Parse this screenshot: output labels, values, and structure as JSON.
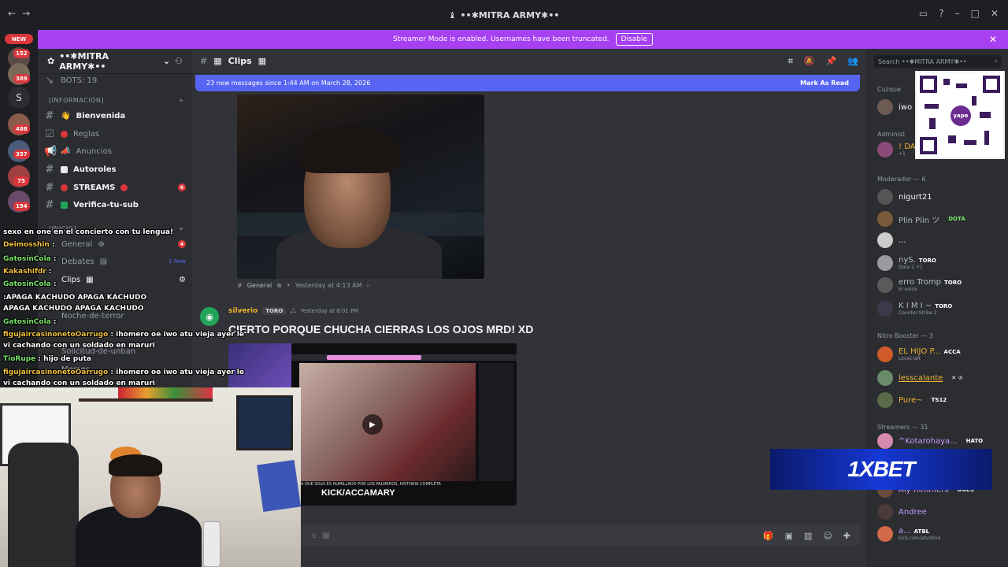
{
  "window": {
    "title": "••✱MITRA ARMY✱••"
  },
  "streamer_mode": {
    "message": "Streamer Mode is enabled. Usernames have been truncated.",
    "disable_label": "Disable"
  },
  "server_rail": {
    "new_label": "NEW",
    "badges": [
      "152",
      "389",
      "488",
      "357",
      "75",
      "194"
    ],
    "letter": "S"
  },
  "server": {
    "name": "••✱MITRA ARMY✱••",
    "bots_label": "BOTS: 19",
    "category_info": "[INFORMACIÓN]",
    "channels": [
      {
        "name": "Bienvenida",
        "bold": true
      },
      {
        "name": "Reglas",
        "bold": false
      },
      {
        "name": "Anuncios",
        "bold": false
      },
      {
        "name": "Autoroles",
        "bold": true
      },
      {
        "name": "STREAMS",
        "bold": true,
        "unread": "6"
      },
      {
        "name": "Verifica-tu-sub",
        "bold": true
      }
    ],
    "category_inicio": "[INICIO]",
    "lower_channels": [
      {
        "name": "General",
        "unread": "4"
      },
      {
        "name": "Debates",
        "note": "1 New"
      },
      {
        "name": "Clips"
      },
      {
        "name": "Noche-de-terror"
      },
      {
        "name": "Solicitud-de-unban"
      },
      {
        "name": "Memes"
      }
    ]
  },
  "channel_header": {
    "name": "Clips",
    "search_placeholder": "Search ••✱MITRA ARMY✱••"
  },
  "new_messages_bar": {
    "text": "23 new messages since 1:44 AM on March 28, 2026",
    "mark_read": "Mark As Read"
  },
  "forwarded": {
    "channel": "General",
    "time": "Yesterday at 4:13 AM"
  },
  "message": {
    "author": "silverio",
    "role": "TORO",
    "time": "Yesterday at 8:01 PM",
    "text": "CIERTO PORQUE CHUCHA CIERRAS LOS OJOS MRD! XD",
    "video_overlay": "KICK/ACCAMARY",
    "video_caption": "A QUE SOLO ES HUMILLADO POR LOS PALMEROS, HISTORIA COMPLETA"
  },
  "composer": {
    "placeholder_fragment": "s"
  },
  "members": {
    "groups": [
      {
        "label": "Cuzque",
        "members": [
          {
            "name": "iwo"
          }
        ]
      },
      {
        "label": "Administ",
        "members": [
          {
            "name": "! DA",
            "sub": "+1"
          }
        ]
      },
      {
        "label": "Moderador — 6",
        "members": [
          {
            "name": "nigurt21"
          },
          {
            "name": "Plin Plin ツ",
            "tag": "DOTA"
          },
          {
            "name": "..."
          },
          {
            "name": "nyS.",
            "tag": "TORO",
            "sub": "Dota 2 +1"
          },
          {
            "name": "erro Tromp",
            "tag": "TORO",
            "sub": "In voice"
          },
          {
            "name": "K I M I ~",
            "tag": "TORO",
            "sub": "Counter-Strike 2"
          }
        ]
      },
      {
        "label": "Nitro Booster — 3",
        "members": [
          {
            "name": "EL HIJO P...",
            "tag": "ACCA",
            "sub": "Lovecraft"
          },
          {
            "name": "lesscalante",
            "tag": "✕ ♔"
          },
          {
            "name": "Pure~",
            "tag": "TS12"
          }
        ]
      },
      {
        "label": "Streamers — 31",
        "members": [
          {
            "name": "^Kotarohaya...",
            "tag": "HATO"
          },
          {
            "name": "Aly Rimmers",
            "tag": "OUES"
          },
          {
            "name": "Andree"
          },
          {
            "name": "a...",
            "tag": "ATBL",
            "sub": "kick.com/atustina"
          }
        ]
      }
    ]
  },
  "qr": {
    "brand": "yape"
  },
  "ad": {
    "text": "1XBET"
  },
  "stream_chat": {
    "lines": [
      {
        "user": "",
        "text": "sexo en one en el concierto con tu lengua!"
      },
      {
        "user": "Deimosshin",
        "text": " :"
      },
      {
        "user": "GatosinCola",
        "text": " :",
        "color": "green"
      },
      {
        "user": "Kakashifdr",
        "text": " :"
      },
      {
        "user": "GatosinCola",
        "text": " :",
        "color": "green"
      },
      {
        "user": "",
        "text": ":APAGA KACHUDO  APAGA KACHUDO"
      },
      {
        "user": "",
        "text": "APAGA KACHUDO  APAGA KACHUDO"
      },
      {
        "user": "GatosinCola",
        "text": " :",
        "color": "green"
      },
      {
        "user": "figujaircasinonetoOarrugo",
        "text": " : ihomero oe iwo atu vieja ayer le"
      },
      {
        "user": "",
        "text": "vi cachando con un soldado en maruri"
      },
      {
        "user": "TioRupe",
        "text": " : hijo de puta",
        "color": "green"
      },
      {
        "user": "figujaircasinonetoOarrugo",
        "text": " : ihomero oe iwo atu vieja ayer le"
      },
      {
        "user": "",
        "text": "vi cachando con un soldado en maruri"
      }
    ]
  },
  "colors": {
    "streamer_banner": "#a640f0",
    "new_messages": "#5865f2",
    "author": "#f0b232",
    "unread_badge": "#da373c"
  }
}
